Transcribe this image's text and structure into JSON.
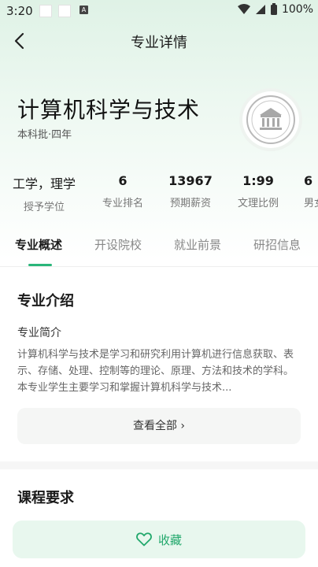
{
  "status_bar": {
    "time": "3:20",
    "notif_letter": "A",
    "battery": "100%"
  },
  "nav": {
    "title": "专业详情"
  },
  "major": {
    "name": "计算机科学与技术",
    "meta": "本科批·四年"
  },
  "stats": [
    {
      "value": "工学，理学",
      "label": "授予学位"
    },
    {
      "value": "6",
      "label": "专业排名"
    },
    {
      "value": "13967",
      "label": "预期薪资"
    },
    {
      "value": "1:99",
      "label": "文理比例"
    },
    {
      "value": "6",
      "label": "男女"
    }
  ],
  "tabs": [
    {
      "label": "专业概述",
      "active": true
    },
    {
      "label": "开设院校"
    },
    {
      "label": "就业前景"
    },
    {
      "label": "研招信息"
    }
  ],
  "intro": {
    "section_title": "专业介绍",
    "label": "专业简介",
    "text": "计算机科学与技术是学习和研究利用计算机进行信息获取、表示、存储、处理、控制等的理论、原理、方法和技术的学科。本专业学生主要学习和掌握计算机科学与技术...",
    "view_all": "查看全部 ›"
  },
  "course_section_title": "课程要求",
  "favorite": {
    "label": "收藏"
  },
  "colors": {
    "accent": "#2ab67a",
    "fav_bg": "#e8f7ee"
  }
}
